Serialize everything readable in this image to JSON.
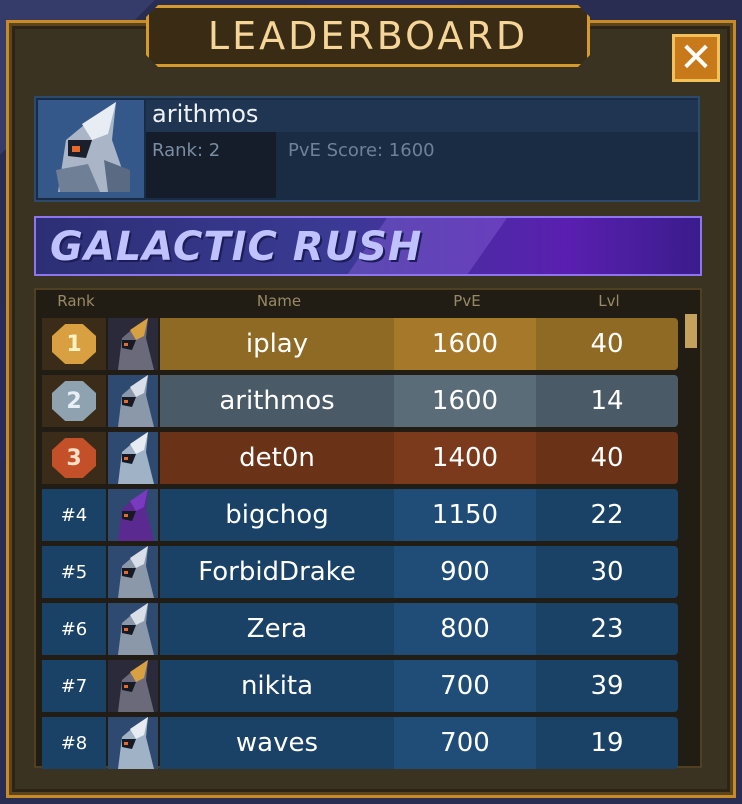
{
  "window": {
    "title": "LEADERBOARD",
    "close_label": "✕"
  },
  "profile": {
    "name": "arithmos",
    "rank": "Rank: 2",
    "score": "PvE Score: 1600"
  },
  "event": {
    "title": "GALACTIC RUSH"
  },
  "table": {
    "headers": [
      "Rank",
      "Name",
      "PvE",
      "Lvl"
    ],
    "rows": [
      {
        "rank": "1",
        "name": "iplay",
        "pve": "1600",
        "lvl": "40"
      },
      {
        "rank": "2",
        "name": "arithmos",
        "pve": "1600",
        "lvl": "14"
      },
      {
        "rank": "3",
        "name": "det0n",
        "pve": "1400",
        "lvl": "40"
      },
      {
        "rank": "#4",
        "name": "bigchog",
        "pve": "1150",
        "lvl": "22"
      },
      {
        "rank": "#5",
        "name": "ForbidDrake",
        "pve": "900",
        "lvl": "30"
      },
      {
        "rank": "#6",
        "name": "Zera",
        "pve": "800",
        "lvl": "23"
      },
      {
        "rank": "#7",
        "name": "nikita",
        "pve": "700",
        "lvl": "39"
      },
      {
        "rank": "#8",
        "name": "waves",
        "pve": "700",
        "lvl": "19"
      }
    ]
  },
  "colors": {
    "gold_row": "#8f6a24",
    "silver_row": "#4a5a66",
    "bronze_row": "#6a3318",
    "default_row": "#1a4266",
    "gold_pve": "#a6782a",
    "silver_pve": "#5b6c79",
    "bronze_pve": "#7b3a1c",
    "default_pve": "#1f4d78"
  }
}
